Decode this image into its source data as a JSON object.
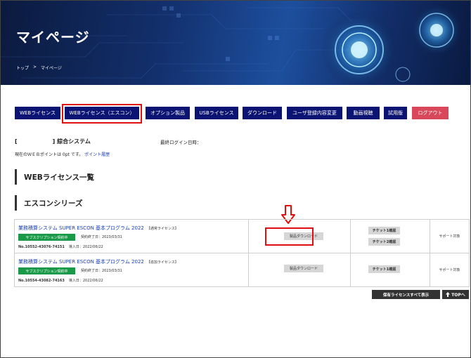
{
  "header": {
    "title": "マイページ",
    "breadcrumb": [
      "トップ",
      ">",
      "マイページ"
    ]
  },
  "nav": {
    "items": [
      {
        "label": "WEBライセンス"
      },
      {
        "label": "WEBライセンス（エスコン）"
      },
      {
        "label": "オプション製品"
      },
      {
        "label": "USBライセンス"
      },
      {
        "label": "ダウンロード"
      },
      {
        "label": "ユーザ登録内容変更"
      },
      {
        "label": "動画視聴"
      },
      {
        "label": "試用版"
      },
      {
        "label": "ログアウト"
      }
    ]
  },
  "info": {
    "system_open": "[",
    "system_close": "] 綜合システム",
    "last_login_label": "最終ログイン日時：",
    "points_text": "現在のＷＥＢポイントは 0pt です。",
    "points_link": "ポイント履歴"
  },
  "sections": {
    "list_title": "WEBライセンス一覧",
    "series_title": "エスコンシリーズ"
  },
  "licenses": [
    {
      "name": "業務積算システム SUPER ESCON 基本プログラム 2022",
      "tag": "【通常ライセンス】",
      "badge": "サブスクリプション契約中",
      "contract_end": "契約終了日：2023/03/31",
      "number": "No.10552-43076-74151",
      "install_date": "導入日：2022/06/22",
      "download_label": "製品ダウンロード",
      "tickets": [
        "チケット1確認",
        "チケット2確認"
      ],
      "support": "サポート対象"
    },
    {
      "name": "業務積算システム SUPER ESCON 基本プログラム 2022",
      "tag": "【追加ライセンス】",
      "badge": "サブスクリプション契約中",
      "contract_end": "契約終了日：2023/03/31",
      "number": "No.10554-43082-74163",
      "install_date": "導入日：2022/06/22",
      "download_label": "製品ダウンロード",
      "tickets": [
        "チケット1確認"
      ],
      "support": "サポート対象"
    }
  ],
  "footer": {
    "show_all_label": "保有ライセンスすべて表示",
    "top_label": "TOPへ"
  },
  "colors": {
    "nav": "#0c1473",
    "logout": "#d9475a",
    "badge": "#1a9a48",
    "highlight": "#e01010"
  }
}
